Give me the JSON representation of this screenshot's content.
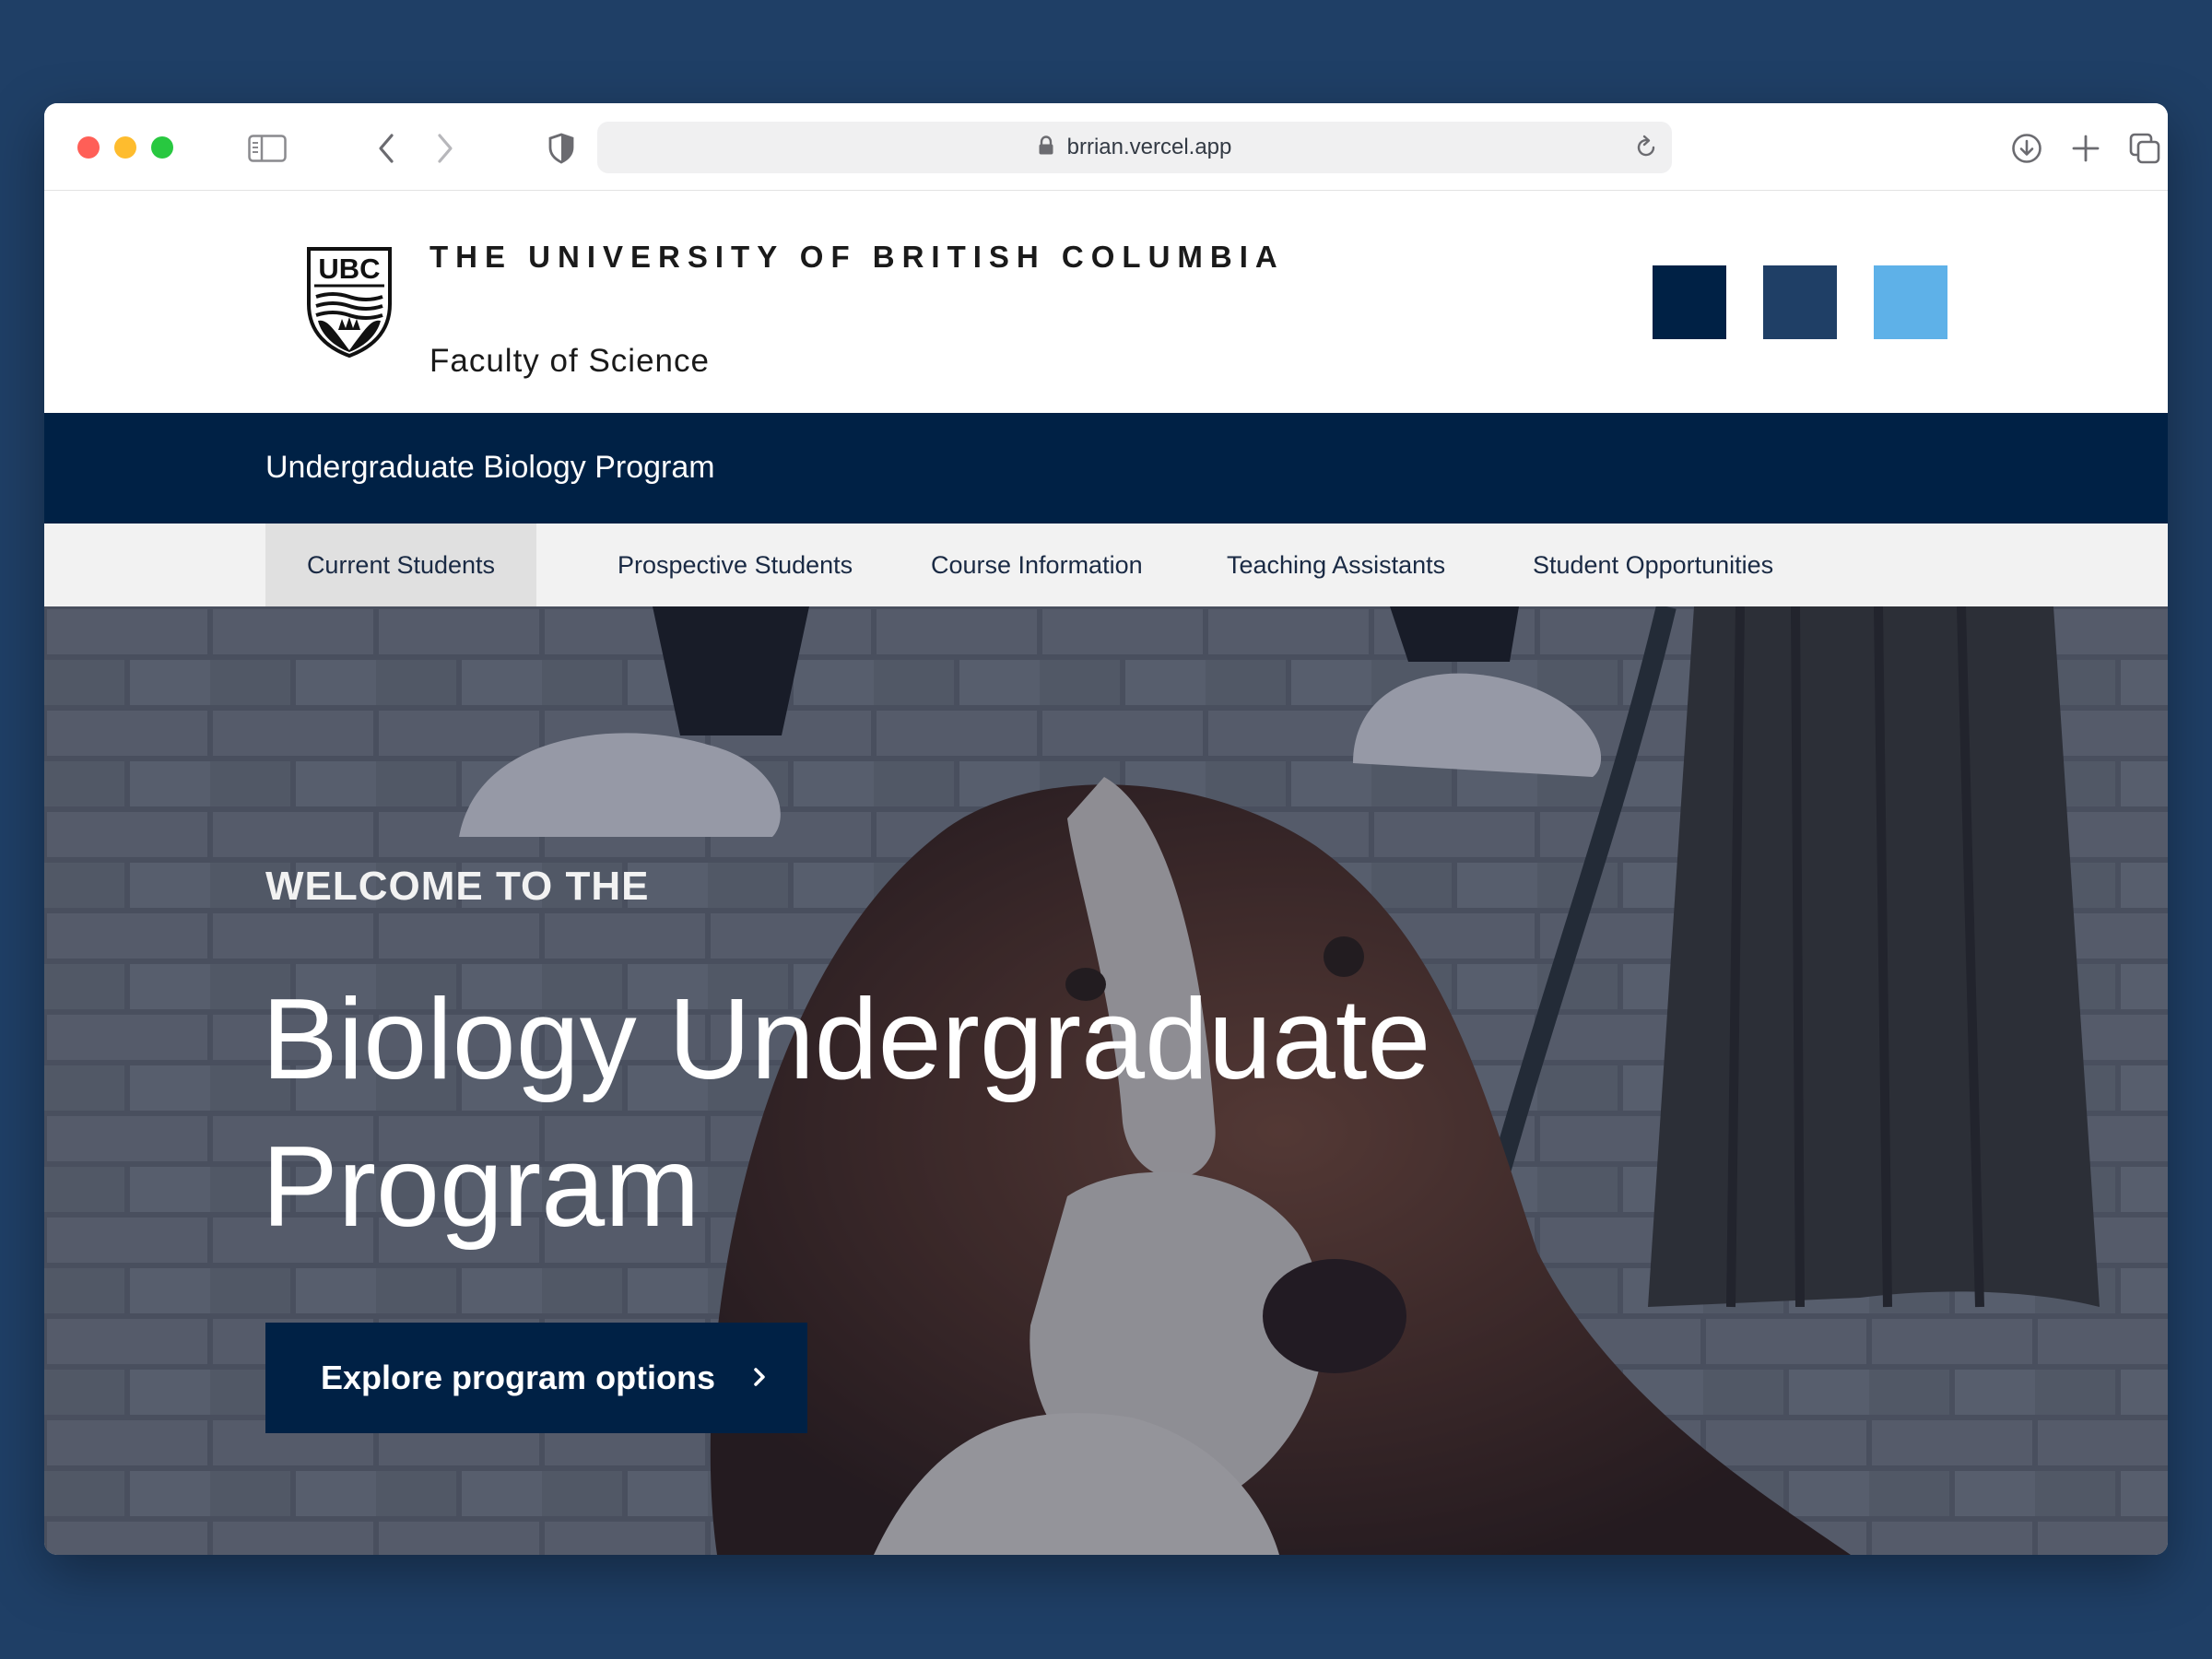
{
  "browser": {
    "url": "brrian.vercel.app"
  },
  "header": {
    "university_name": "THE UNIVERSITY OF BRITISH COLUMBIA",
    "crest_text": "UBC",
    "faculty": "Faculty of Science",
    "swatch_colors": [
      "#002145",
      "#1f3f66",
      "#5eb1e8"
    ]
  },
  "unit_bar": {
    "title": "Undergraduate Biology Program"
  },
  "nav": {
    "items": [
      {
        "label": "Current Students",
        "active": true
      },
      {
        "label": "Prospective Students",
        "active": false
      },
      {
        "label": "Course Information",
        "active": false
      },
      {
        "label": "Teaching Assistants",
        "active": false
      },
      {
        "label": "Student Opportunities",
        "active": false
      }
    ]
  },
  "hero": {
    "kicker": "WELCOME TO THE",
    "title": "Biology Undergraduate Program",
    "cta_label": "Explore program options",
    "cta_icon": "chevron-right-icon"
  },
  "colors": {
    "brand_navy": "#002145",
    "page_background": "#1f3f66",
    "nav_background": "#f2f2f2",
    "nav_active_background": "#e0e0e0"
  }
}
